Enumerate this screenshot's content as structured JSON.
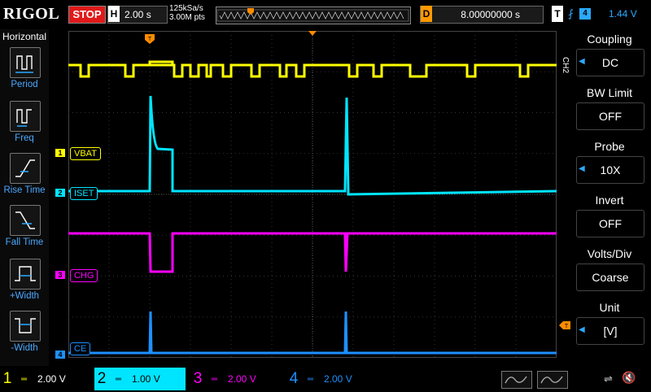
{
  "brand": "RIGOL",
  "run_state": "STOP",
  "horizontal": {
    "label": "H",
    "timebase": "2.00 s",
    "sample_rate": "125kSa/s",
    "memory_depth": "3.00M pts"
  },
  "delay": {
    "label": "D",
    "value": "8.00000000 s"
  },
  "trigger": {
    "label": "T",
    "edge": "⨏",
    "source": "4",
    "level": "1.44 V"
  },
  "left_menu": {
    "title": "Horizontal",
    "items": [
      {
        "label": "Period",
        "icon": "period-icon"
      },
      {
        "label": "Freq",
        "icon": "freq-icon"
      },
      {
        "label": "Rise Time",
        "icon": "rise-time-icon"
      },
      {
        "label": "Fall Time",
        "icon": "fall-time-icon"
      },
      {
        "label": "+Width",
        "icon": "pos-width-icon"
      },
      {
        "label": "-Width",
        "icon": "neg-width-icon"
      }
    ]
  },
  "channels": [
    {
      "num": "1",
      "name": "VBAT",
      "color": "#ffff00",
      "scale": "2.00 V"
    },
    {
      "num": "2",
      "name": "ISET",
      "color": "#00e5ff",
      "scale": "1.00 V"
    },
    {
      "num": "3",
      "name": "CHG",
      "color": "#ff00ff",
      "scale": "2.00 V"
    },
    {
      "num": "4",
      "name": "CE",
      "color": "#1e90ff",
      "scale": "2.00 V"
    }
  ],
  "right_menu": {
    "channel_tag": "CH2",
    "items": [
      {
        "title": "Coupling",
        "value": "DC"
      },
      {
        "title": "BW Limit",
        "value": "OFF"
      },
      {
        "title": "Probe",
        "value": "10X"
      },
      {
        "title": "Invert",
        "value": "OFF"
      },
      {
        "title": "Volts/Div",
        "value": "Coarse"
      },
      {
        "title": "Unit",
        "value": "[V]"
      }
    ]
  },
  "colors": {
    "trigger_orange": "#ff8c00",
    "stop_red": "#e01a1a",
    "menu_blue": "#2aa9ff"
  }
}
